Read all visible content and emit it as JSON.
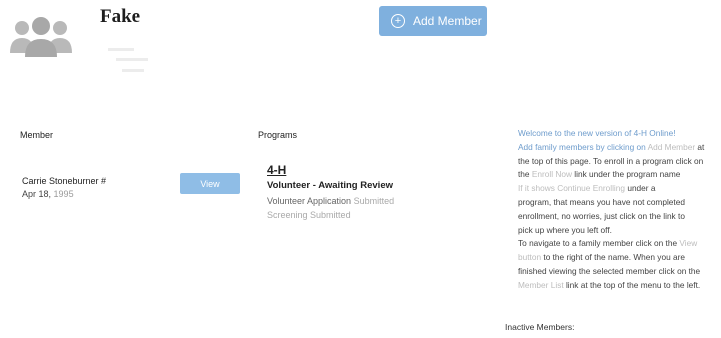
{
  "header": {
    "family_name": "Fake",
    "add_member_label": "Add Member"
  },
  "columns": {
    "member": "Member",
    "programs": "Programs"
  },
  "member": {
    "name": "Carrie Stoneburner #",
    "date_prefix": "Apr 18,",
    "date_year": "1995",
    "view_label": "View"
  },
  "program": {
    "title": "4-H",
    "status": "Volunteer - Awaiting Review",
    "line1_a": "Volunteer Application",
    "line1_b": "Submitted",
    "line2_a": "Screening",
    "line2_b": "Submitted"
  },
  "welcome": {
    "l1": "Welcome to the new version of 4-H Online!",
    "l2a": "Add family members by clicking on",
    "l2b": "Add Member",
    "l2c": "at",
    "l3": "the top of this page. To enroll in a program click on",
    "l4a": "the",
    "l4b": "Enroll Now",
    "l4c": "link under the program name",
    "l5a": "If it shows",
    "l5b": "Continue Enrolling",
    "l5c": "under a",
    "l6": "program, that means you have not completed",
    "l7": "enrollment, no worries, just click on the link to",
    "l8": "pick up where you left off.",
    "l9a": "To navigate to a family member click on the",
    "l9b": "View",
    "l10a": "button",
    "l10b": "to the right of the name. When you are",
    "l11": "finished viewing the selected member click on the",
    "l12a": "Member List",
    "l12b": "link at the top of the menu to the left."
  },
  "inactive_label": "Inactive Members:"
}
